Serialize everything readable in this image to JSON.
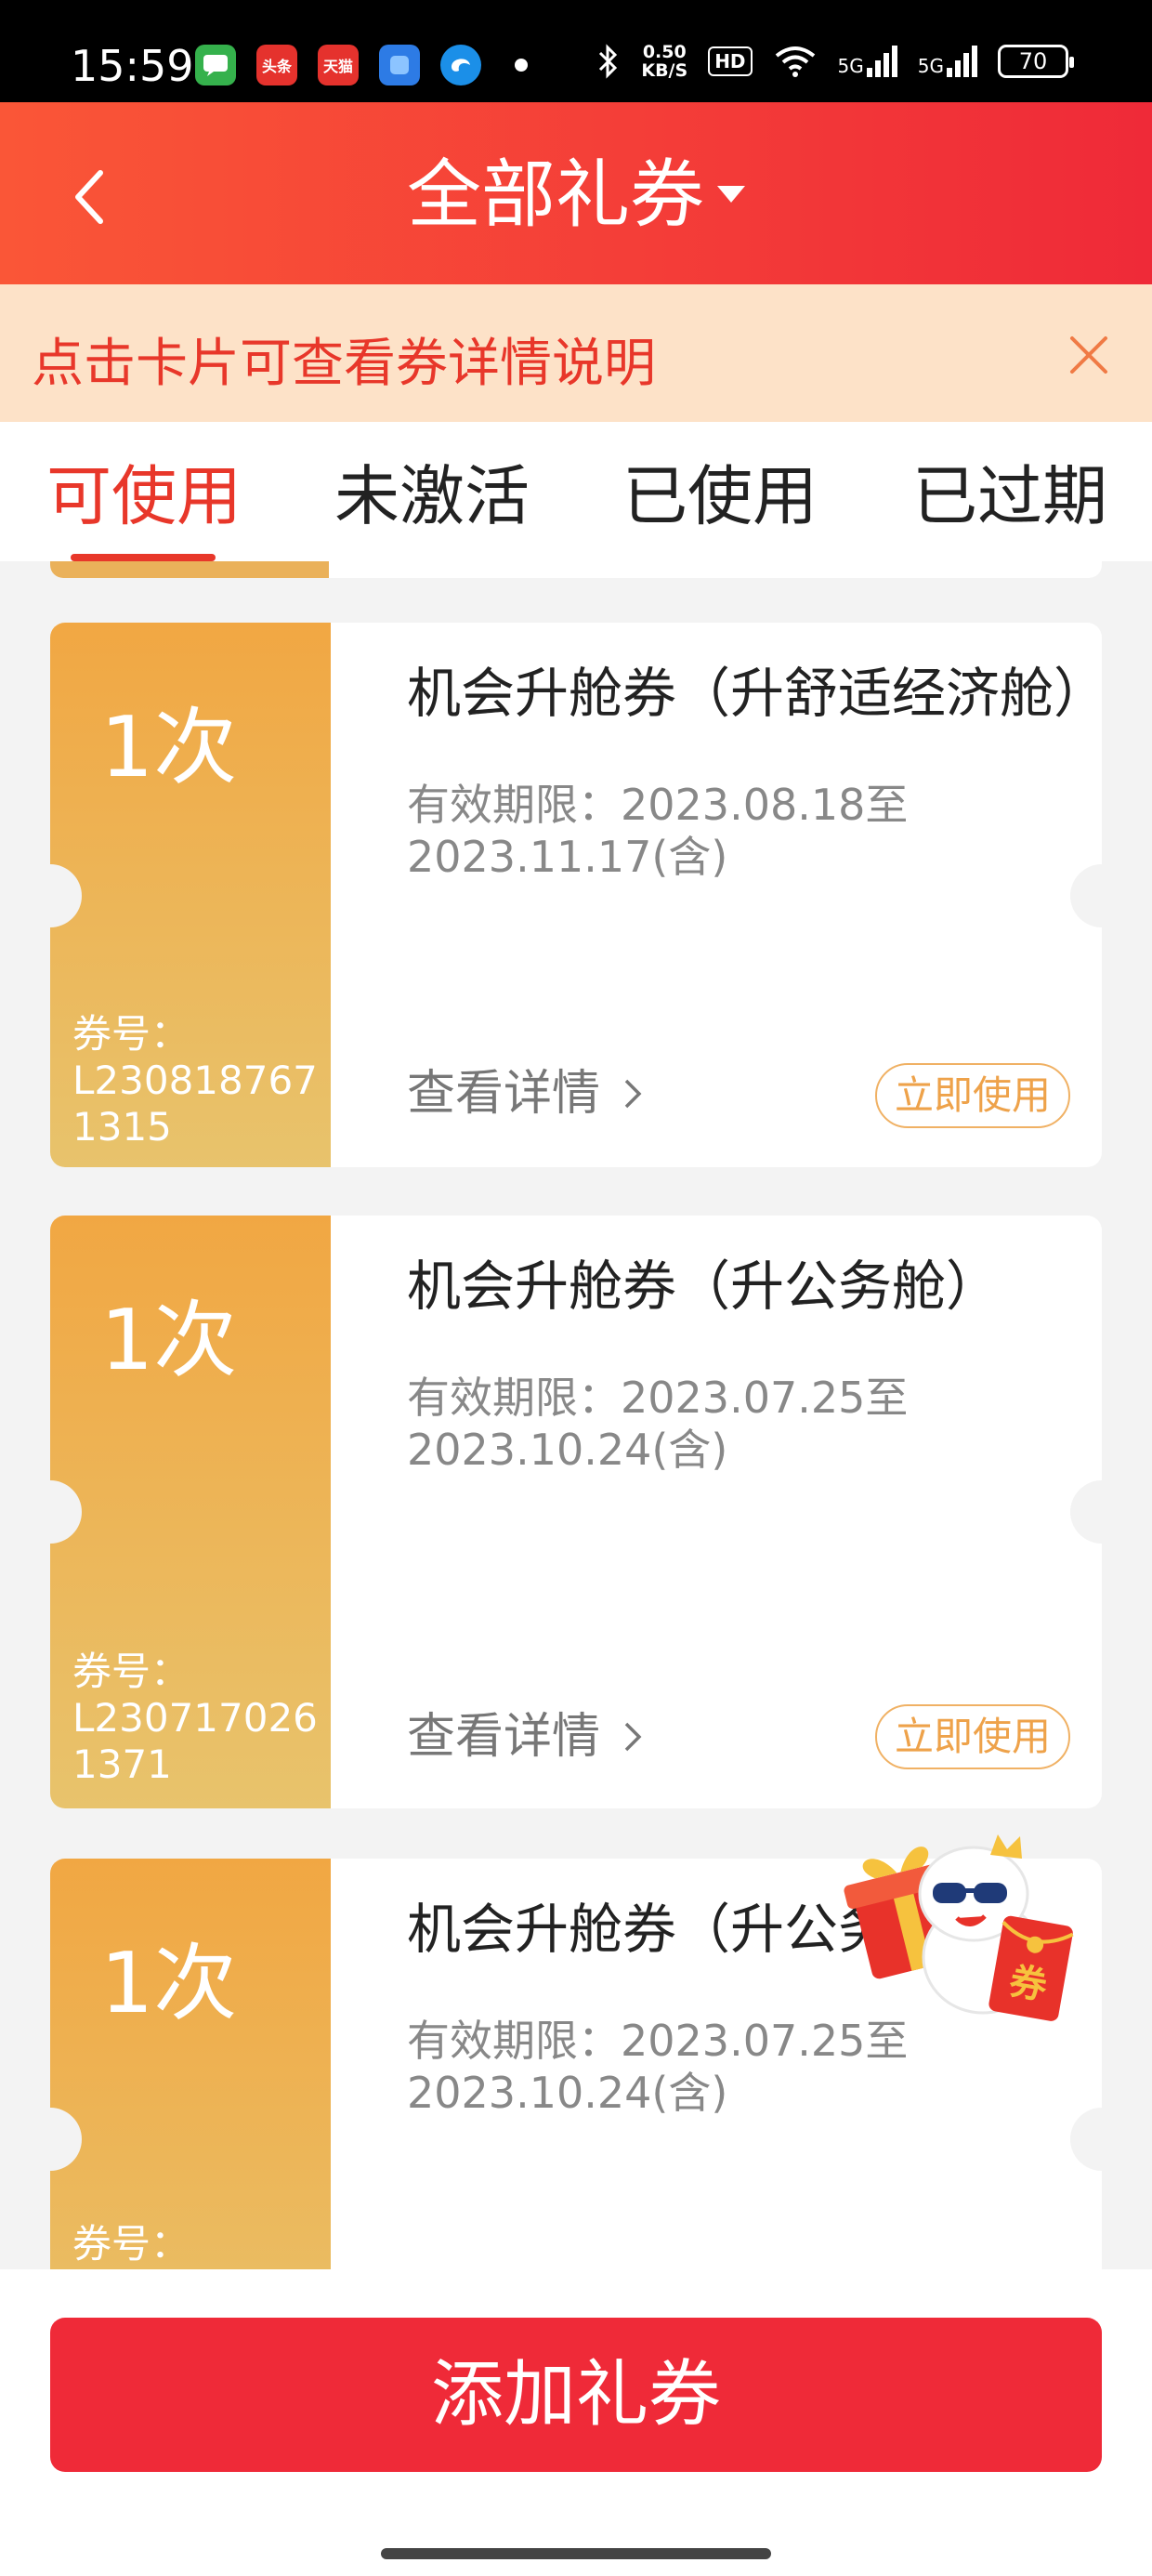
{
  "status_bar": {
    "time": "15:59",
    "apps": [
      {
        "icon": "messages-icon",
        "color": "#35b14c",
        "text": ""
      },
      {
        "icon": "toutiao-icon",
        "color": "#e5322d",
        "text": "头条"
      },
      {
        "icon": "tmall-icon",
        "color": "#e5322d",
        "text": "天猫"
      },
      {
        "icon": "blue-app-icon",
        "color": "#2d7be5",
        "text": ""
      },
      {
        "icon": "edge-browser-icon",
        "color": "#1b8fe8",
        "text": ""
      }
    ],
    "net_speed_value": "0.50",
    "net_speed_unit": "KB/S",
    "hd_label": "HD",
    "sig1_label": "5G",
    "sig2_label": "5G",
    "battery": "70"
  },
  "header": {
    "title": "全部礼券"
  },
  "notice": {
    "text": "点击卡片可查看券详情说明"
  },
  "tabs": [
    {
      "label": "可使用",
      "active": true
    },
    {
      "label": "未激活",
      "active": false
    },
    {
      "label": "已使用",
      "active": false
    },
    {
      "label": "已过期",
      "active": false
    }
  ],
  "coupons": [
    {
      "count": "1次",
      "code_label": "券号：",
      "code": "L2308187671315",
      "title": "机会升舱券（升舒适经济舱）",
      "validity": "有效期限：2023.08.18至2023.11.17(含)",
      "detail": "查看详情",
      "use": "立即使用"
    },
    {
      "count": "1次",
      "code_label": "券号：",
      "code": "L2307170261371",
      "title": "机会升舱券（升公务舱）",
      "validity": "有效期限：2023.07.25至2023.10.24(含)",
      "detail": "查看详情",
      "use": "立即使用"
    },
    {
      "count": "1次",
      "code_label": "券号：",
      "code": "",
      "title": "机会升舱券（升公务",
      "validity": "有效期限：2023.07.25至2023.10.24(含)",
      "detail": "",
      "use": ""
    }
  ],
  "mascot": {
    "envelope_text": "券"
  },
  "bottom": {
    "add_button": "添加礼券"
  },
  "colors": {
    "brand_red": "#ef2a38",
    "coupon_gold": "#f1a743",
    "notice_bg": "#fde2c8"
  }
}
